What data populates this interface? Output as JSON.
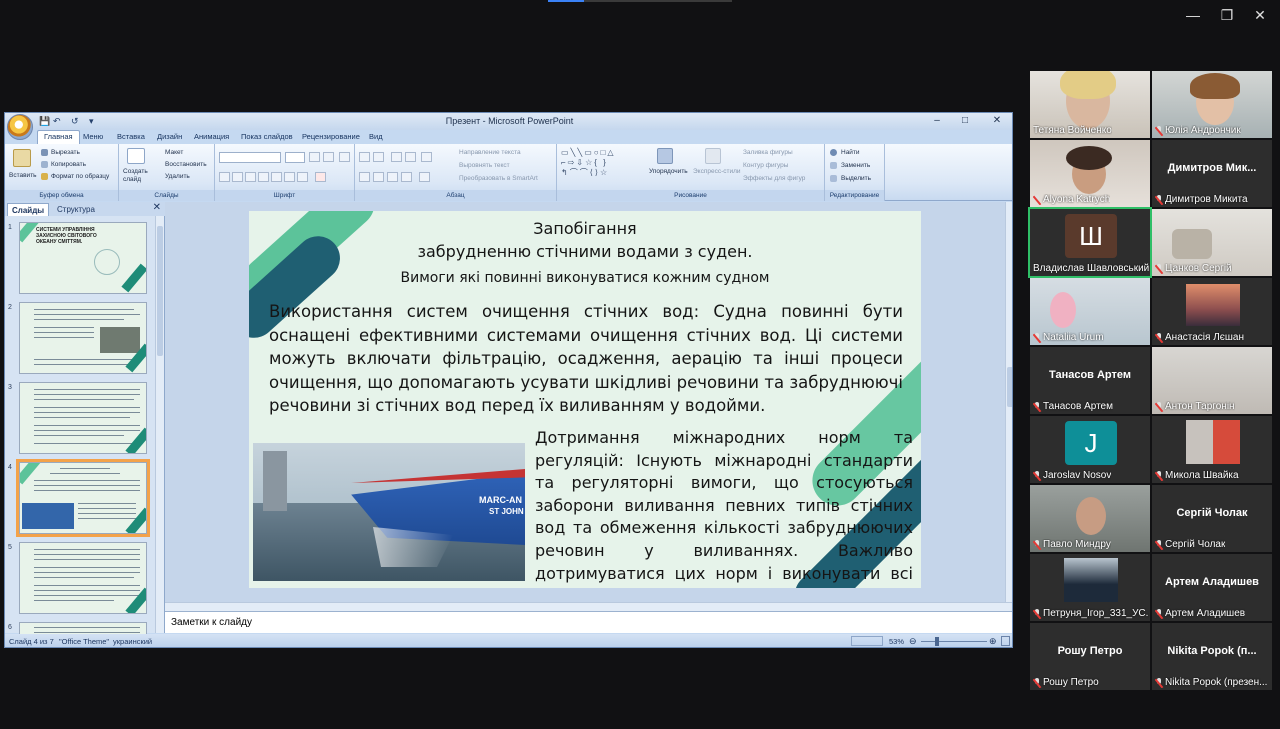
{
  "app": {
    "title": "Презент - Microsoft PowerPoint",
    "ribbon_tabs": [
      "Главная",
      "Меню",
      "Вставка",
      "Дизайн",
      "Анимация",
      "Показ слайдов",
      "Рецензирование",
      "Вид"
    ],
    "clipboard": {
      "paste": "Вставить",
      "cut": "Вырезать",
      "copy": "Копировать",
      "format": "Формат по образцу",
      "group": "Буфер обмена"
    },
    "slides_group": {
      "create": "Создать слайд",
      "layout": "Макет",
      "reset": "Восстановить",
      "delete": "Удалить",
      "group": "Слайды"
    },
    "font_group": {
      "group": "Шрифт"
    },
    "para_group": {
      "direction": "Направление текста",
      "align": "Выровнять текст",
      "smartart": "Преобразовать в SmartArt",
      "group": "Абзац"
    },
    "draw_group": {
      "arrange": "Упорядочить",
      "styles": "Экспресс-стили",
      "fill": "Заливка фигуры",
      "outline": "Контур фигуры",
      "effects": "Эффекты для фигур",
      "group": "Рисование"
    },
    "edit_group": {
      "find": "Найти",
      "replace": "Заменить",
      "select": "Выделить",
      "group": "Редактирование"
    }
  },
  "panel": {
    "tab_slides": "Слайды",
    "tab_structure": "Структура",
    "close": "✕"
  },
  "notes": "Заметки к слайду",
  "status": {
    "slide": "Слайд 4 из 7",
    "theme": "\"Office Theme\"",
    "lang": "украинский",
    "zoom": "53%"
  },
  "slide": {
    "title1": "Запобігання",
    "title2": "забрудненню стічними водами з суден.",
    "title3": "Вимоги які повинні виконуватися кожним судном",
    "para1": "Використання систем очищення стічних вод: Судна повинні бути оснащені ефективними системами очищення стічних вод. Ці системи можуть включати фільтрацію, осадження, аерацію та інші процеси очищення, що допомагають усувати шкідливі речовини та забруднюючі речовини зі стічних вод перед їх виливанням у водойми.",
    "para2": "Дотримання міжнародних норм та регуляцій: Існують міжнародні стандарти та регуляторні вимоги, що стосуються заборони виливання певних типів стічних вод та обмеження кількості забруднюючих речовин у виливаннях. Важливо дотримуватися цих норм і виконувати всі вимоги, що стосуються обробки та виливання стічних вод.",
    "ship_text1": "MARC-AN",
    "ship_text2": "ST JOHN"
  },
  "thumbs": [
    {
      "num": "1",
      "text": "СИСТЕМИ УПРАВЛІННЯ ЗАХИСНОЮ СВІТОВОГО ОКЕАНУ СМІТТЯМ."
    },
    {
      "num": "2"
    },
    {
      "num": "3"
    },
    {
      "num": "4"
    },
    {
      "num": "5"
    },
    {
      "num": "6"
    }
  ],
  "participants": [
    {
      "name": "Тетяна Войченко",
      "muted": false,
      "type": "video"
    },
    {
      "name": "Юлія Андрончик",
      "muted": true,
      "type": "video"
    },
    {
      "name": "Alyona Katrych",
      "muted": true,
      "type": "video"
    },
    {
      "name": "Димитров Микита",
      "big": "Димитров Мик...",
      "muted": true,
      "type": "name"
    },
    {
      "name": "Владислав Шавловський",
      "letter": "Ш",
      "muted": false,
      "type": "avatar",
      "color": "#5a3a2c"
    },
    {
      "name": "Цанков Сергій",
      "muted": true,
      "type": "video"
    },
    {
      "name": "Nataliia Urum",
      "muted": true,
      "type": "video"
    },
    {
      "name": "Анастасія Лєшан",
      "muted": true,
      "type": "video"
    },
    {
      "name": "Танасов Артем",
      "big": "Танасов Артем",
      "muted": true,
      "type": "name"
    },
    {
      "name": "Антон Таргонін",
      "muted": true,
      "type": "video"
    },
    {
      "name": "Jaroslav Nosov",
      "letter": "J",
      "muted": true,
      "type": "avatar",
      "color": "#0e8f98"
    },
    {
      "name": "Микола Швайка",
      "muted": true,
      "type": "video"
    },
    {
      "name": "Павло Миндру",
      "muted": true,
      "type": "video"
    },
    {
      "name": "Сергій Чолак",
      "big": "Сергій Чолак",
      "muted": true,
      "type": "name"
    },
    {
      "name": "Петруня_Ігор_331_УС...",
      "muted": true,
      "type": "video"
    },
    {
      "name": "Артем Аладишев",
      "big": "Артем Аладишев",
      "muted": true,
      "type": "name"
    },
    {
      "name": "Рошу Петро",
      "big": "Рошу Петро",
      "muted": true,
      "type": "name"
    },
    {
      "name": "Nikita Popok (презен...",
      "big": "Nikita Popok (п...",
      "muted": true,
      "type": "name"
    }
  ],
  "colors": {
    "stripe_teal": "#1f5f72",
    "stripe_mint": "#5cc39a",
    "slide_bg": "#e6f3ea"
  }
}
